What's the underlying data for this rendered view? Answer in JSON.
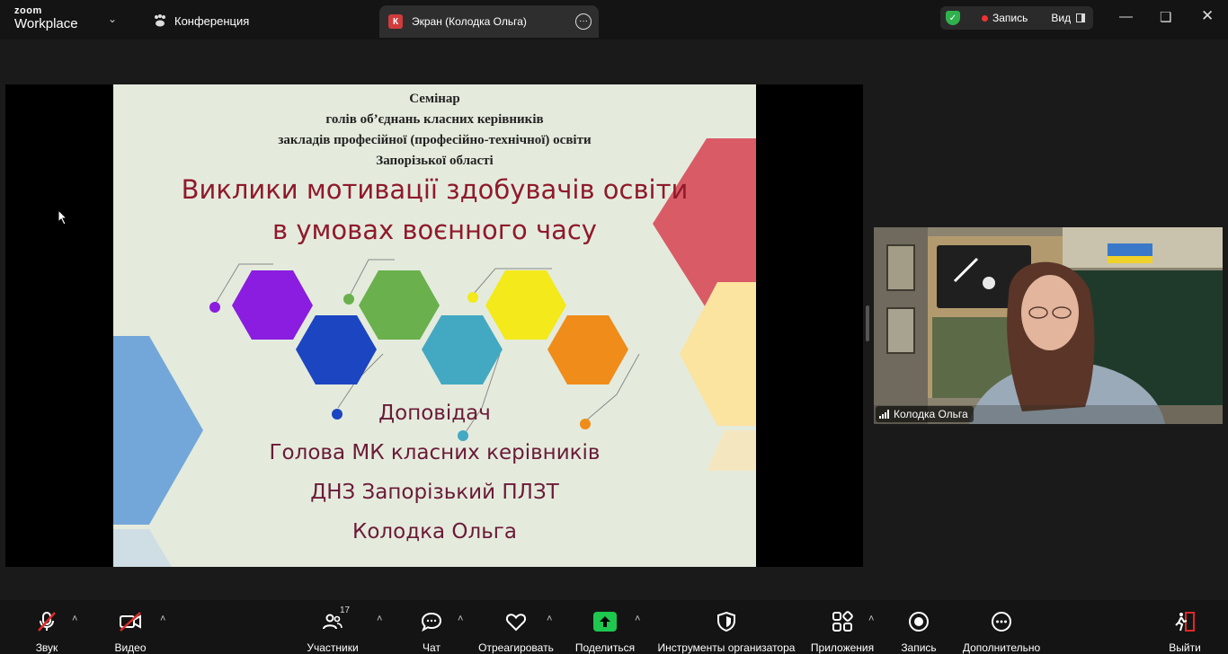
{
  "app": {
    "brand_top": "zoom",
    "brand_bottom": "Workplace",
    "tabs": [
      {
        "label": "Конференция"
      },
      {
        "label": "Экран (Колодка Ольга)",
        "badge": "К"
      }
    ],
    "recording_label": "Запись",
    "view_label": "Вид"
  },
  "slide": {
    "heading_lines": [
      "Семінар",
      "голів об’єднань класних керівників",
      "закладів професійної (професійно-технічної) освіти",
      "Запорізької області"
    ],
    "title_lines": [
      "Виклики мотивації здобувачів освіти",
      "в умовах воєнного часу"
    ],
    "speaker_lines": [
      "Доповідач",
      "Голова МК класних керівників",
      "ДНЗ Запорізький ПЛЗТ",
      "Колодка Ольга"
    ]
  },
  "participant": {
    "name": "Колодка Ольга"
  },
  "toolbar": {
    "audio": "Звук",
    "video": "Видео",
    "participants": "Участники",
    "participants_count": "17",
    "chat": "Чат",
    "react": "Отреагировать",
    "share": "Поделиться",
    "host_tools": "Инструменты организатора",
    "apps": "Приложения",
    "record": "Запись",
    "more": "Дополнительно",
    "leave": "Выйти"
  },
  "colors": {
    "accent_green": "#2fb14d",
    "share_green": "#1ec74d",
    "leave_red": "#e02828",
    "slide_bg": "#e4ebdd",
    "title_color": "#8f1a2b"
  }
}
